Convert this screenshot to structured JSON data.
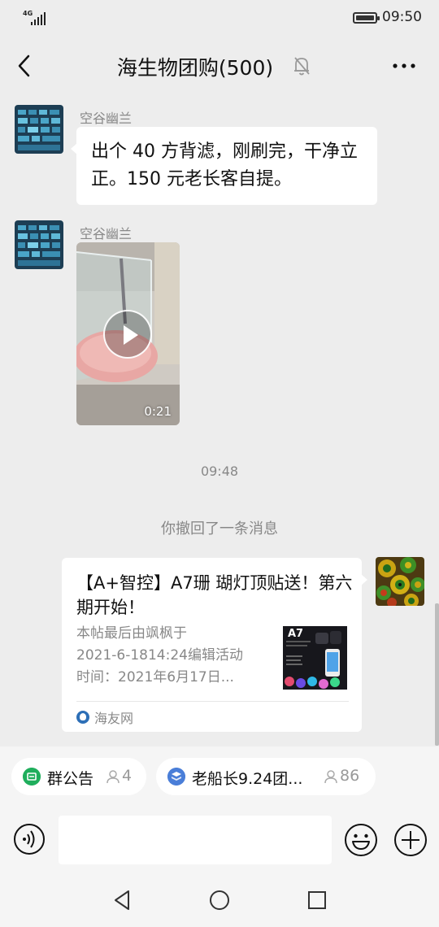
{
  "status_bar": {
    "network": "4G",
    "time": "09:50"
  },
  "header": {
    "title": "海生物团购(500)"
  },
  "messages": [
    {
      "sender": "空谷幽兰",
      "text": "出个 40 方背滤，刚刷完，干净立正。150 元老长客自提。"
    },
    {
      "sender": "空谷幽兰",
      "video_duration": "0:21"
    }
  ],
  "timestamp": "09:48",
  "recall_notice": "你撤回了一条消息",
  "link_card": {
    "title": "【A+智控】A7珊 瑚灯顶贴送！第六期开始！",
    "description_lines": [
      "本帖最后由飒枫于",
      "2021-6-1814:24编辑活动",
      "时间：2021年6月17日..."
    ],
    "thumb_label": "A7",
    "source": "海友网"
  },
  "chips": {
    "announcement": {
      "label": "群公告",
      "count": "4"
    },
    "group": {
      "label": "老船长9.24团...",
      "count": "86"
    }
  },
  "input": {
    "placeholder": ""
  },
  "colors": {
    "background": "#ededed",
    "bubble": "#ffffff",
    "bar": "#f5f5f5",
    "secondary_text": "#888888",
    "announce_green": "#1fae5c",
    "group_blue": "#4a7ed8"
  },
  "icons": [
    "back-arrow-icon",
    "mute-bell-icon",
    "more-dots-icon",
    "play-icon",
    "announcement-icon",
    "group-icon",
    "user-icon",
    "voice-icon",
    "emoji-icon",
    "plus-icon",
    "nav-back-icon",
    "nav-home-icon",
    "nav-recent-icon"
  ]
}
